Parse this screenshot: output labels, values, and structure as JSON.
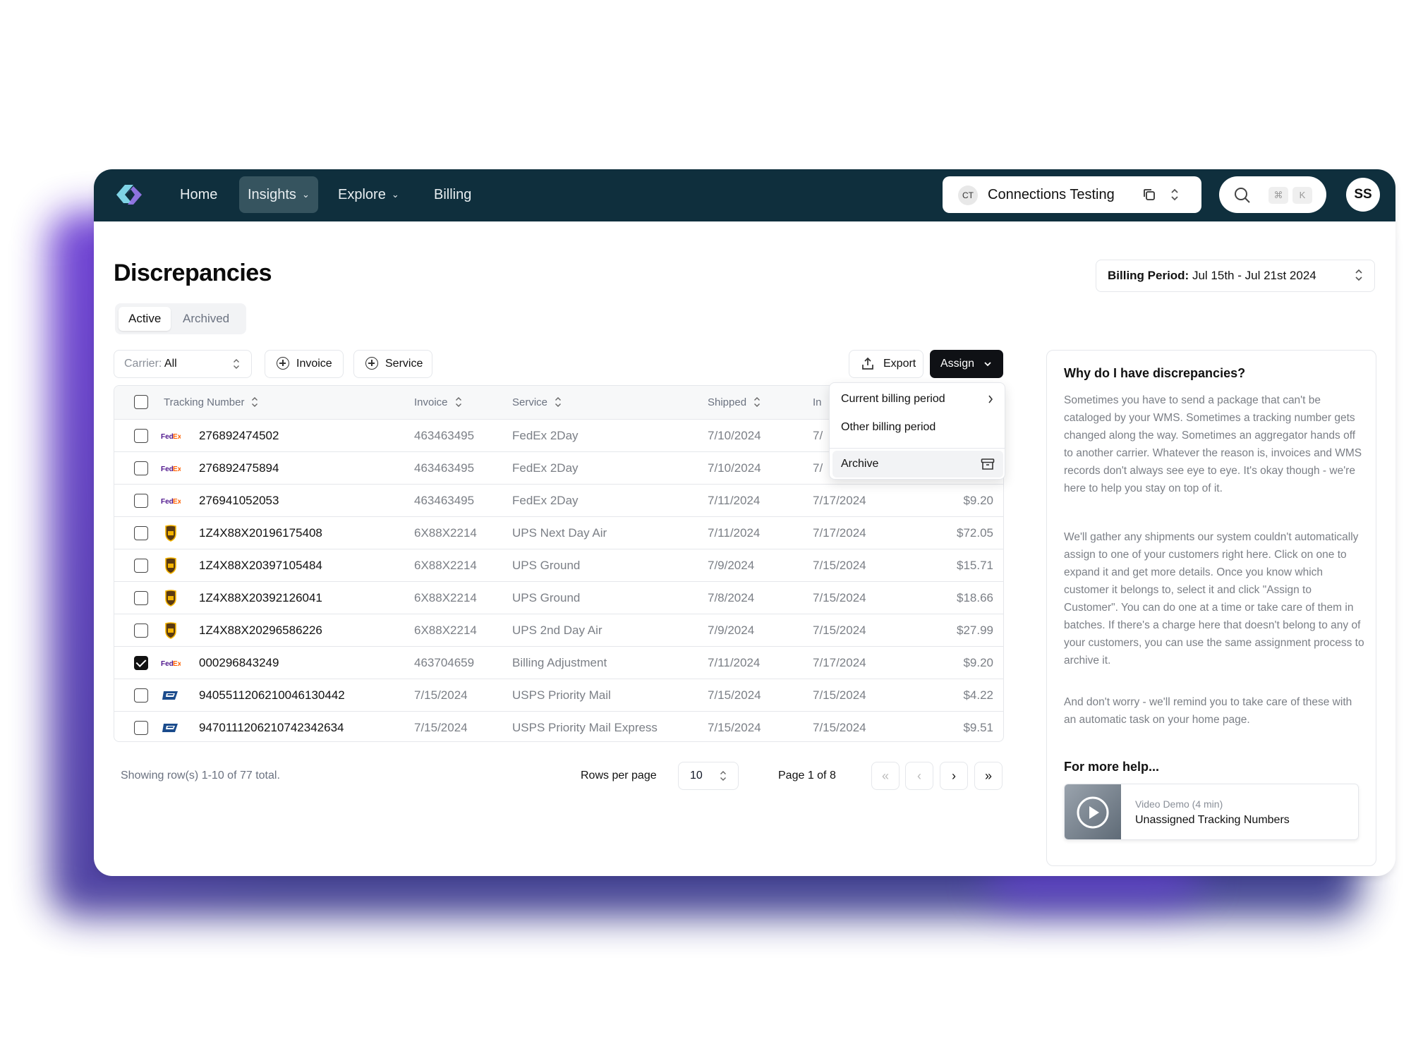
{
  "nav": {
    "items": [
      {
        "label": "Home"
      },
      {
        "label": "Insights"
      },
      {
        "label": "Explore"
      },
      {
        "label": "Billing"
      }
    ],
    "org_initials": "CT",
    "org_name": "Connections Testing",
    "kbd": [
      "⌘",
      "K"
    ],
    "avatar": "SS"
  },
  "page": {
    "title": "Discrepancies",
    "tabs": [
      {
        "label": "Active"
      },
      {
        "label": "Archived"
      }
    ],
    "billing_period_label": "Billing Period:",
    "billing_period_value": "Jul 15th - Jul 21st 2024"
  },
  "toolbar": {
    "carrier_label": "Carrier:",
    "carrier_value": "All",
    "invoice_label": "Invoice",
    "service_label": "Service",
    "export_label": "Export",
    "assign_label": "Assign"
  },
  "menu": {
    "items": [
      {
        "label": "Current billing period"
      },
      {
        "label": "Other billing period"
      },
      {
        "label": "Archive"
      }
    ]
  },
  "table": {
    "columns": [
      "Tracking Number",
      "Invoice",
      "Service",
      "Shipped",
      "In"
    ],
    "rows": [
      {
        "carrier": "fedex",
        "tracking": "276892474502",
        "invoice": "463463495",
        "service": "FedEx 2Day",
        "shipped": "7/10/2024",
        "invoiced": "7/",
        "amount": "",
        "checked": false
      },
      {
        "carrier": "fedex",
        "tracking": "276892475894",
        "invoice": "463463495",
        "service": "FedEx 2Day",
        "shipped": "7/10/2024",
        "invoiced": "7/",
        "amount": "",
        "checked": false
      },
      {
        "carrier": "fedex",
        "tracking": "276941052053",
        "invoice": "463463495",
        "service": "FedEx 2Day",
        "shipped": "7/11/2024",
        "invoiced": "7/17/2024",
        "amount": "$9.20",
        "checked": false
      },
      {
        "carrier": "ups",
        "tracking": "1Z4X88X20196175408",
        "invoice": "6X88X2214",
        "service": "UPS Next Day Air",
        "shipped": "7/11/2024",
        "invoiced": "7/17/2024",
        "amount": "$72.05",
        "checked": false
      },
      {
        "carrier": "ups",
        "tracking": "1Z4X88X20397105484",
        "invoice": "6X88X2214",
        "service": "UPS Ground",
        "shipped": "7/9/2024",
        "invoiced": "7/15/2024",
        "amount": "$15.71",
        "checked": false
      },
      {
        "carrier": "ups",
        "tracking": "1Z4X88X20392126041",
        "invoice": "6X88X2214",
        "service": "UPS Ground",
        "shipped": "7/8/2024",
        "invoiced": "7/15/2024",
        "amount": "$18.66",
        "checked": false
      },
      {
        "carrier": "ups",
        "tracking": "1Z4X88X20296586226",
        "invoice": "6X88X2214",
        "service": "UPS 2nd Day Air",
        "shipped": "7/9/2024",
        "invoiced": "7/15/2024",
        "amount": "$27.99",
        "checked": false
      },
      {
        "carrier": "fedex",
        "tracking": "000296843249",
        "invoice": "463704659",
        "service": "Billing Adjustment",
        "shipped": "7/11/2024",
        "invoiced": "7/17/2024",
        "amount": "$9.20",
        "checked": true
      },
      {
        "carrier": "usps",
        "tracking": "9405511206210046130442",
        "invoice": "7/15/2024",
        "service": "USPS Priority Mail",
        "shipped": "7/15/2024",
        "invoiced": "7/15/2024",
        "amount": "$4.22",
        "checked": false
      },
      {
        "carrier": "usps",
        "tracking": "9470111206210742342634",
        "invoice": "7/15/2024",
        "service": "USPS Priority Mail Express",
        "shipped": "7/15/2024",
        "invoiced": "7/15/2024",
        "amount": "$9.51",
        "checked": false
      }
    ]
  },
  "footer": {
    "showing": "Showing row(s) 1-10 of 77 total.",
    "rows_per_page_label": "Rows per page",
    "rows_per_page_value": "10",
    "page_label": "Page 1 of 8"
  },
  "help": {
    "title": "Why do I have discrepancies?",
    "p1": "Sometimes you have to send a package that can't be cataloged by your WMS. Sometimes a tracking number gets changed along the way. Sometimes an aggregator hands off to another carrier. Whatever the reason is, invoices and WMS records don't always see eye to eye. It's okay though - we're here to help you stay on top of it.",
    "p2": "We'll gather any shipments our system couldn't automatically assign to one of your customers right here. Click on one to expand it and get more details. Once you know which customer it belongs to, select it and click \"Assign to Customer\". You can do one at a time or take care of them in batches. If there's a charge here that doesn't belong to any of your customers, you can use the same assignment process to archive it.",
    "p3": "And don't worry - we'll remind you to take care of these with an automatic task on your home page.",
    "more_help": "For more help...",
    "video_meta": "Video Demo (4 min)",
    "video_title": "Unassigned Tracking Numbers"
  },
  "colors": {
    "nav_bg": "#0f2f3d",
    "accent_dark": "#0f1115",
    "glow": "#5a3cc8"
  }
}
